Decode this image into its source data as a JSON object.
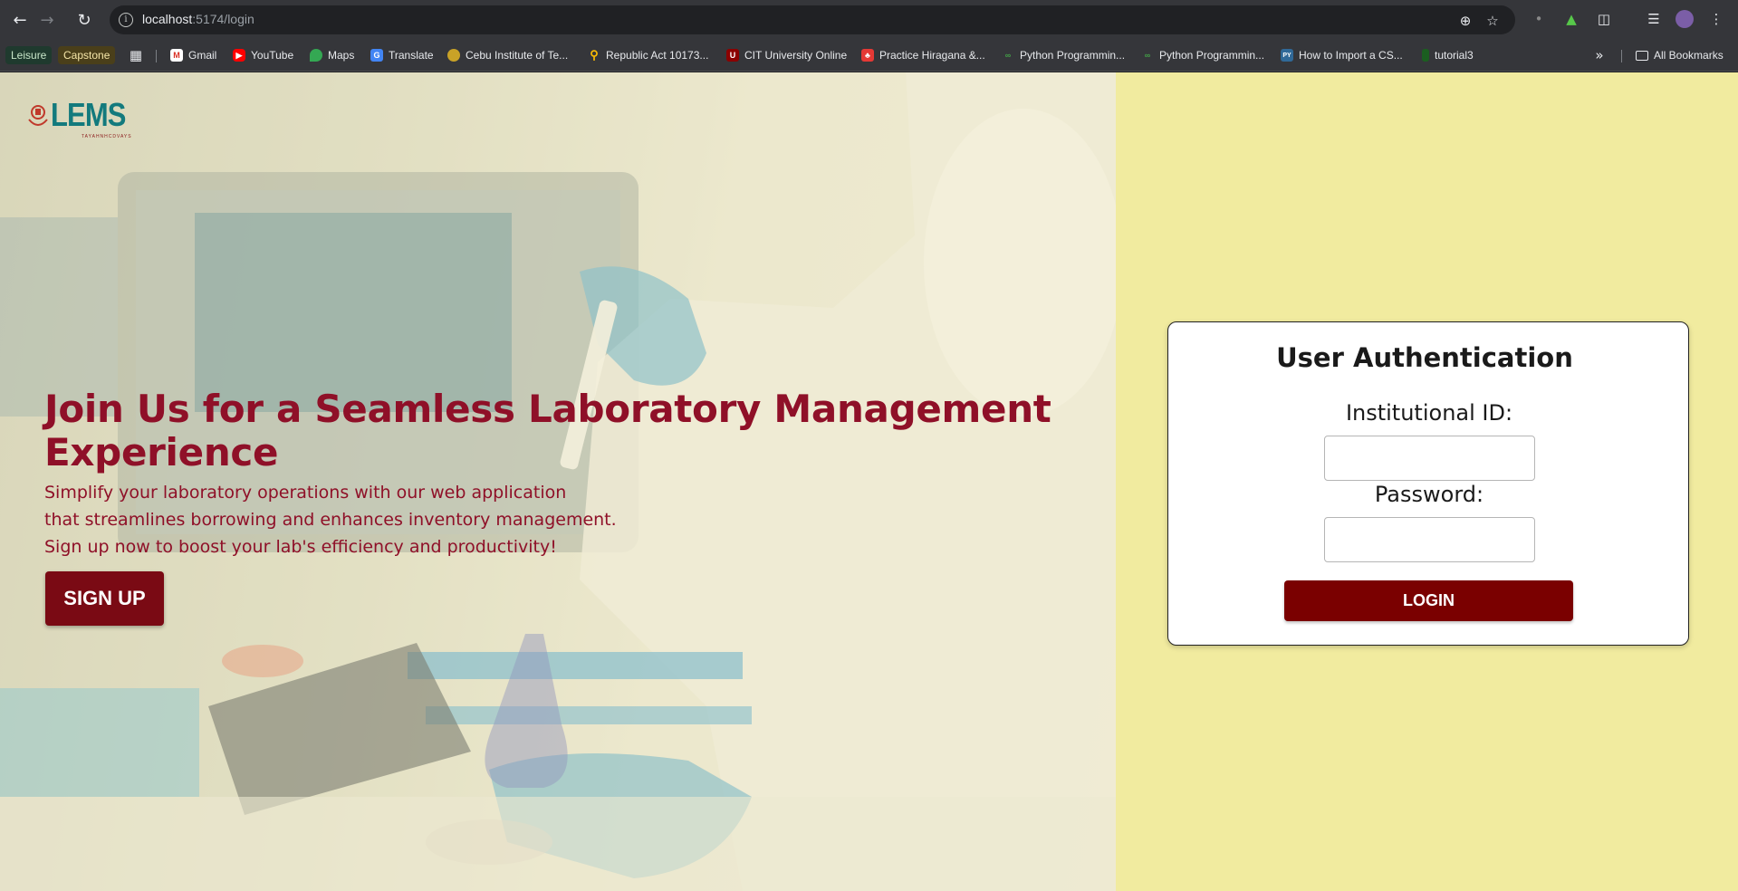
{
  "browser": {
    "url_host": "localhost",
    "url_rest": ":5174/login",
    "bookmarks": [
      {
        "label": "Leisure",
        "kind": "chip",
        "bg": "#1f3a2e",
        "color": "#c8e6c9"
      },
      {
        "label": "Capstone",
        "kind": "chip",
        "bg": "#4a3f1a",
        "color": "#f5e6a8"
      },
      {
        "label": "Gmail",
        "icon": "gmail-icon"
      },
      {
        "label": "YouTube",
        "icon": "youtube-icon"
      },
      {
        "label": "Maps",
        "icon": "maps-icon"
      },
      {
        "label": "Translate",
        "icon": "translate-icon"
      },
      {
        "label": "Cebu Institute of Te...",
        "icon": "cit-icon"
      },
      {
        "label": "Republic Act 10173...",
        "icon": "pin-icon"
      },
      {
        "label": "CIT University Online",
        "icon": "cit-online-icon"
      },
      {
        "label": "Practice Hiragana &...",
        "icon": "hiragana-icon"
      },
      {
        "label": "Python Programmin...",
        "icon": "python-icon"
      },
      {
        "label": "Python Programmin...",
        "icon": "python-icon"
      },
      {
        "label": "How to Import a CS...",
        "icon": "py-icon"
      },
      {
        "label": "tutorial3",
        "icon": "tutorial-icon"
      }
    ],
    "all_bookmarks": "All Bookmarks"
  },
  "logo": {
    "text": "LEMS",
    "sub": "TAYAHNHCDVAYS"
  },
  "hero": {
    "title": "Join Us for a Seamless Laboratory Management Experience",
    "desc_line1": "Simplify your laboratory operations with our web application",
    "desc_line2": "that streamlines borrowing and enhances inventory management.",
    "desc_line3": "Sign up now to boost your lab's efficiency and productivity!",
    "signup_label": "SIGN UP"
  },
  "auth": {
    "title": "User Authentication",
    "id_label": "Institutional ID:",
    "id_value": "",
    "password_label": "Password:",
    "password_value": "",
    "login_label": "LOGIN"
  },
  "colors": {
    "accent": "#8f1028",
    "button": "#7a0000",
    "right_bg": "#f1eb9f",
    "logo": "#137a7d"
  }
}
